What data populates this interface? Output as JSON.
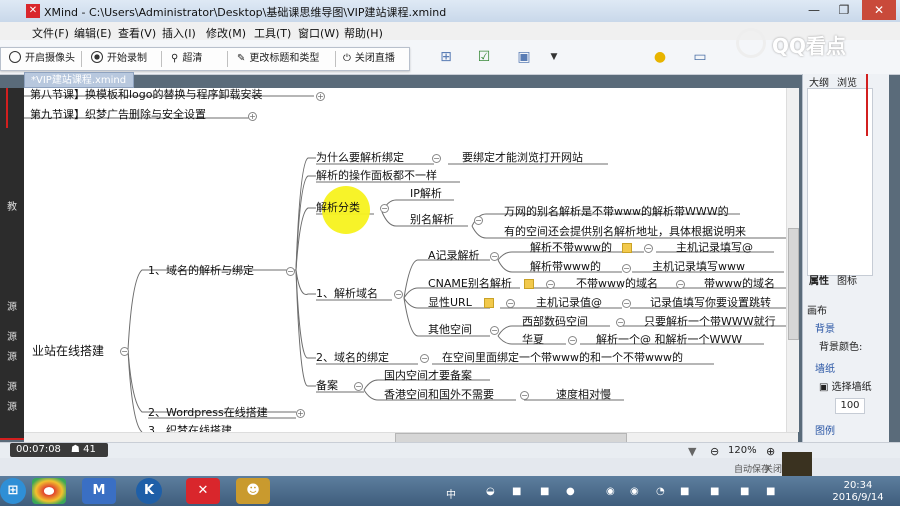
{
  "window": {
    "title": "XMind - C:\\Users\\Administrator\\Desktop\\基础课思维导图\\VIP建站课程.xmind",
    "tab": "*VIP建站课程.xmind"
  },
  "menu": [
    "文件(F)",
    "编辑(E)",
    "查看(V)",
    "插入(I)",
    "修改(M)",
    "工具(T)",
    "窗口(W)",
    "帮助(H)"
  ],
  "recorder": {
    "camera": "开启摄像头",
    "record": "开始录制",
    "hd": "超清",
    "edit_title": "更改标题和类型",
    "close": "关闭直播",
    "time": "00:07:08",
    "viewers": "41"
  },
  "watermark": "QQ看点",
  "mindmap": {
    "root": "业站在线搭建",
    "prev1": "第八节课】换模板和logo的替换与程序卸载安装",
    "prev2": "第九节课】织梦广告删除与安全设置",
    "b1": "1、域名的解析与绑定",
    "b1_1": "为什么要解析绑定",
    "b1_1a": "要绑定才能浏览打开网站",
    "b1_2": "解析的操作面板都不一样",
    "b1_3": "解析分类",
    "b1_3a": "IP解析",
    "b1_3b": "别名解析",
    "b1_3b1": "万网的别名解析是不带www的解析带WWW的",
    "b1_3b2": "有的空间还会提供别名解析地址，具体根据说明来",
    "b1_4": "1、解析域名",
    "b1_4a": "A记录解析",
    "b1_4a1": "解析不带www的",
    "b1_4a1b": "主机记录填写@",
    "b1_4a2": "解析带www的",
    "b1_4a2b": "主机记录填写www",
    "b1_4b": "CNAME别名解析",
    "b1_4b1": "不带www的域名",
    "b1_4b2": "带www的域名",
    "b1_4c": "显性URL",
    "b1_4c1": "主机记录值@",
    "b1_4c2": "记录值填写你要设置跳转",
    "b1_4d": "其他空间",
    "b1_4d1": "西部数码空间",
    "b1_4d1b": "只要解析一个带WWW就行",
    "b1_4d2": "华夏",
    "b1_4d2b": "解析一个@ 和解析一个WWW",
    "b1_5": "2、域名的绑定",
    "b1_5a": "在空间里面绑定一个带www的和一个不带www的",
    "b1_6": "备案",
    "b1_6a": "国内空间才要备案",
    "b1_6b": "香港空间和国外不需要",
    "b1_6b1": "速度相对慢",
    "b2": "2、Wordpress在线搭建",
    "b3": "3、织梦在线搭建"
  },
  "right_panel": {
    "tab1": "大纲",
    "tab2": "浏览",
    "tab3": "属性",
    "tab4": "图标",
    "section1": "画布",
    "bg": "背景",
    "bgcolor": "背景颜色:",
    "wall": "墙纸",
    "wallsel": "选择墙纸",
    "opacity": "100",
    "legend": "图例"
  },
  "status": {
    "zoom": "120%",
    "autosave": "自动保存",
    "autosave_state": "关闭"
  },
  "left_strip": [
    "教",
    "源",
    "源",
    "源",
    "源",
    "源"
  ],
  "clock": {
    "time": "20:34",
    "date": "2016/9/14"
  },
  "taskbar": {
    "ime": "中"
  }
}
